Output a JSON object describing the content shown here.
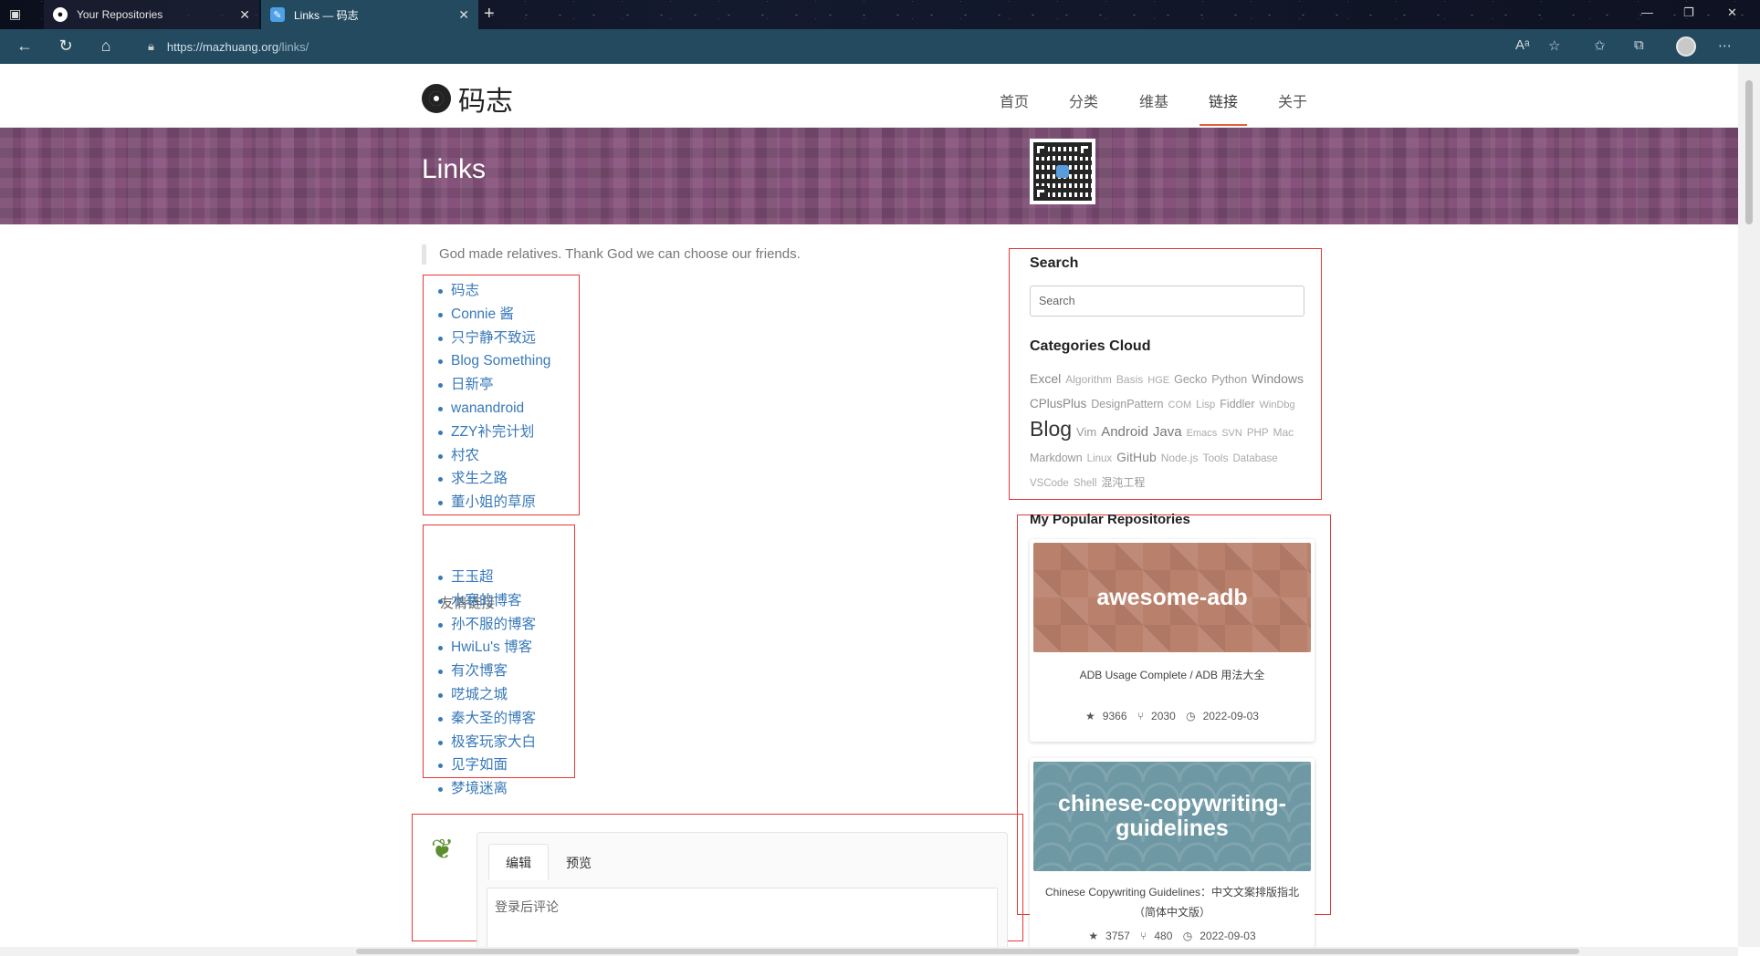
{
  "browser": {
    "tabs": [
      {
        "title": "Your Repositories",
        "active": false,
        "icon": "github-icon"
      },
      {
        "title": "Links — 码志",
        "active": true,
        "icon": "site-icon"
      }
    ],
    "url_host": "https://mazhuang.org",
    "url_path": "/links/"
  },
  "site": {
    "brand": "码志",
    "menu": [
      "首页",
      "分类",
      "维基",
      "链接",
      "关于"
    ],
    "active_menu": "链接"
  },
  "banner": {
    "title": "Links"
  },
  "quote": "God made relatives. Thank God we can choose our friends.",
  "links": [
    "码志",
    "Connie 酱",
    "只宁静不致远",
    "Blog Something",
    "日新亭",
    "wanandroid",
    "ZZY补完计划",
    "村农",
    "求生之路",
    "董小姐的草原"
  ],
  "friends": {
    "title": "友情链接",
    "items": [
      "王玉超",
      "水寒的博客",
      "孙不服的博客",
      "HwiLu's 博客",
      "有次博客",
      "呓城之城",
      "秦大圣的博客",
      "极客玩家大白",
      "见字如面",
      "梦境迷离"
    ]
  },
  "comment": {
    "tabs": [
      "编辑",
      "预览"
    ],
    "placeholder": "登录后评论"
  },
  "sidebar": {
    "search_title": "Search",
    "search_placeholder": "Search",
    "cloud_title": "Categories Cloud",
    "cloud": [
      "Excel",
      "Algorithm",
      "Basis",
      "HGE",
      "Gecko",
      "Python",
      "Windows",
      "CPlusPlus",
      "DesignPattern",
      "COM",
      "Lisp",
      "Fiddler",
      "WinDbg",
      "Blog",
      "Vim",
      "Android",
      "Java",
      "Emacs",
      "SVN",
      "PHP",
      "Mac",
      "Markdown",
      "Linux",
      "GitHub",
      "Node.js",
      "Tools",
      "Database",
      "VSCode",
      "Shell",
      "混沌工程"
    ],
    "repos_title": "My Popular Repositories",
    "repos": [
      {
        "name": "awesome-adb",
        "desc": "ADB Usage Complete / ADB 用法大全",
        "stars": "9366",
        "forks": "2030",
        "date": "2022-09-03"
      },
      {
        "name": "chinese-copywriting-guidelines",
        "desc": "Chinese Copywriting Guidelines：中文文案排版指北（简体中文版）",
        "stars": "3757",
        "forks": "480",
        "date": "2022-09-03"
      }
    ]
  }
}
